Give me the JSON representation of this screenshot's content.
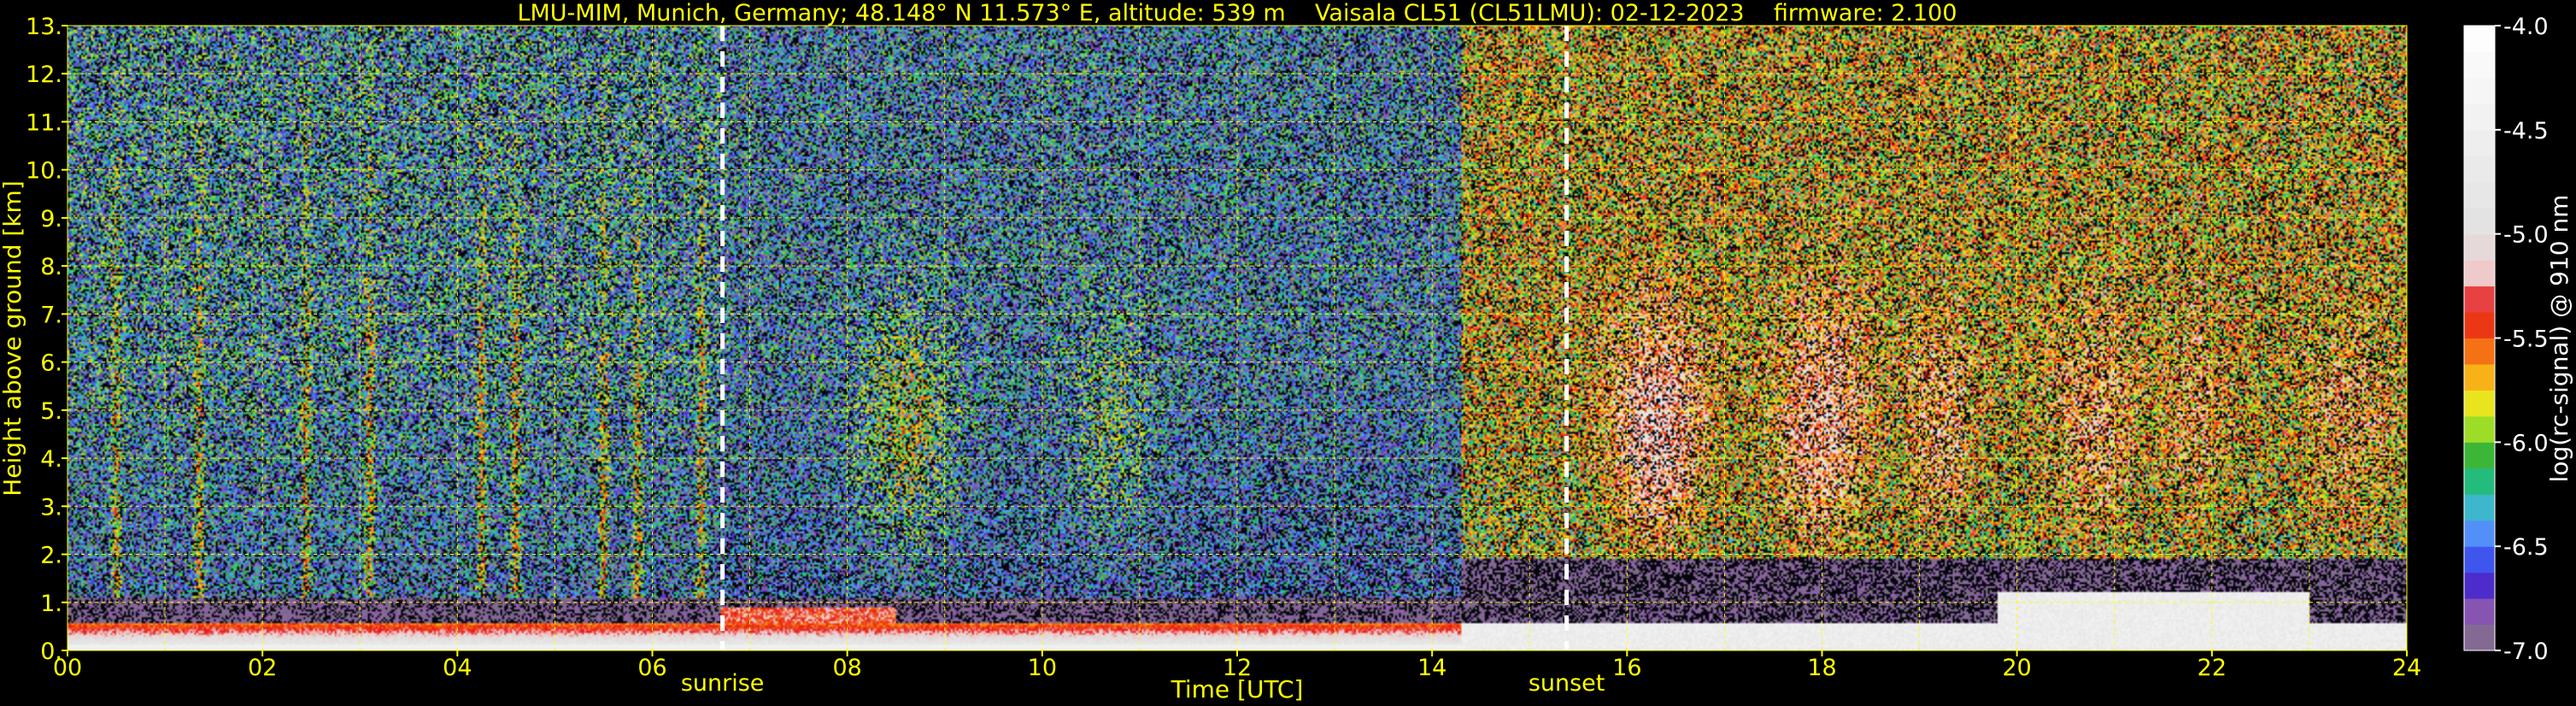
{
  "chart_data": {
    "type": "heatmap",
    "title": "LMU-MIM, Munich, Germany; 48.148° N 11.573° E, altitude: 539 m    Vaisala CL51 (CL51LMU): 02-12-2023    firmware: 2.100",
    "xlabel": "Time [UTC]",
    "ylabel": "Height above ground [km]",
    "xlim": [
      0,
      24
    ],
    "ylim": [
      0,
      13
    ],
    "x_ticks": [
      "00",
      "02",
      "04",
      "06",
      "08",
      "10",
      "12",
      "14",
      "16",
      "18",
      "20",
      "22",
      "24"
    ],
    "y_ticks": [
      "0.",
      "1.",
      "2.",
      "3.",
      "4.",
      "5.",
      "6.",
      "7.",
      "8.",
      "9.",
      "10.",
      "11.",
      "12.",
      "13."
    ],
    "grid": true,
    "grid_color": "#ffff00",
    "markers": [
      {
        "label": "sunrise",
        "time": 6.72
      },
      {
        "label": "sunset",
        "time": 15.38
      }
    ],
    "colorbar": {
      "label": "log(rc-signal) @ 910 nm",
      "range": [
        -7.0,
        -4.0
      ],
      "ticks": [
        "-7.0",
        "-6.5",
        "-6.0",
        "-5.5",
        "-5.0",
        "-4.5",
        "-4.0"
      ]
    },
    "regions": [
      {
        "time": [
          0,
          6.72
        ],
        "description_level": -6.6,
        "noise_top_km": 13
      },
      {
        "time": [
          6.72,
          14.3
        ],
        "description_level": -6.7,
        "noise_top_km": 13
      },
      {
        "time": [
          14.3,
          24
        ],
        "description_level": -6.0,
        "noise_top_km": 13
      }
    ]
  },
  "colors": {
    "background": "#000000",
    "text": "#ffff00",
    "colorbar_label": "#ffffff"
  }
}
